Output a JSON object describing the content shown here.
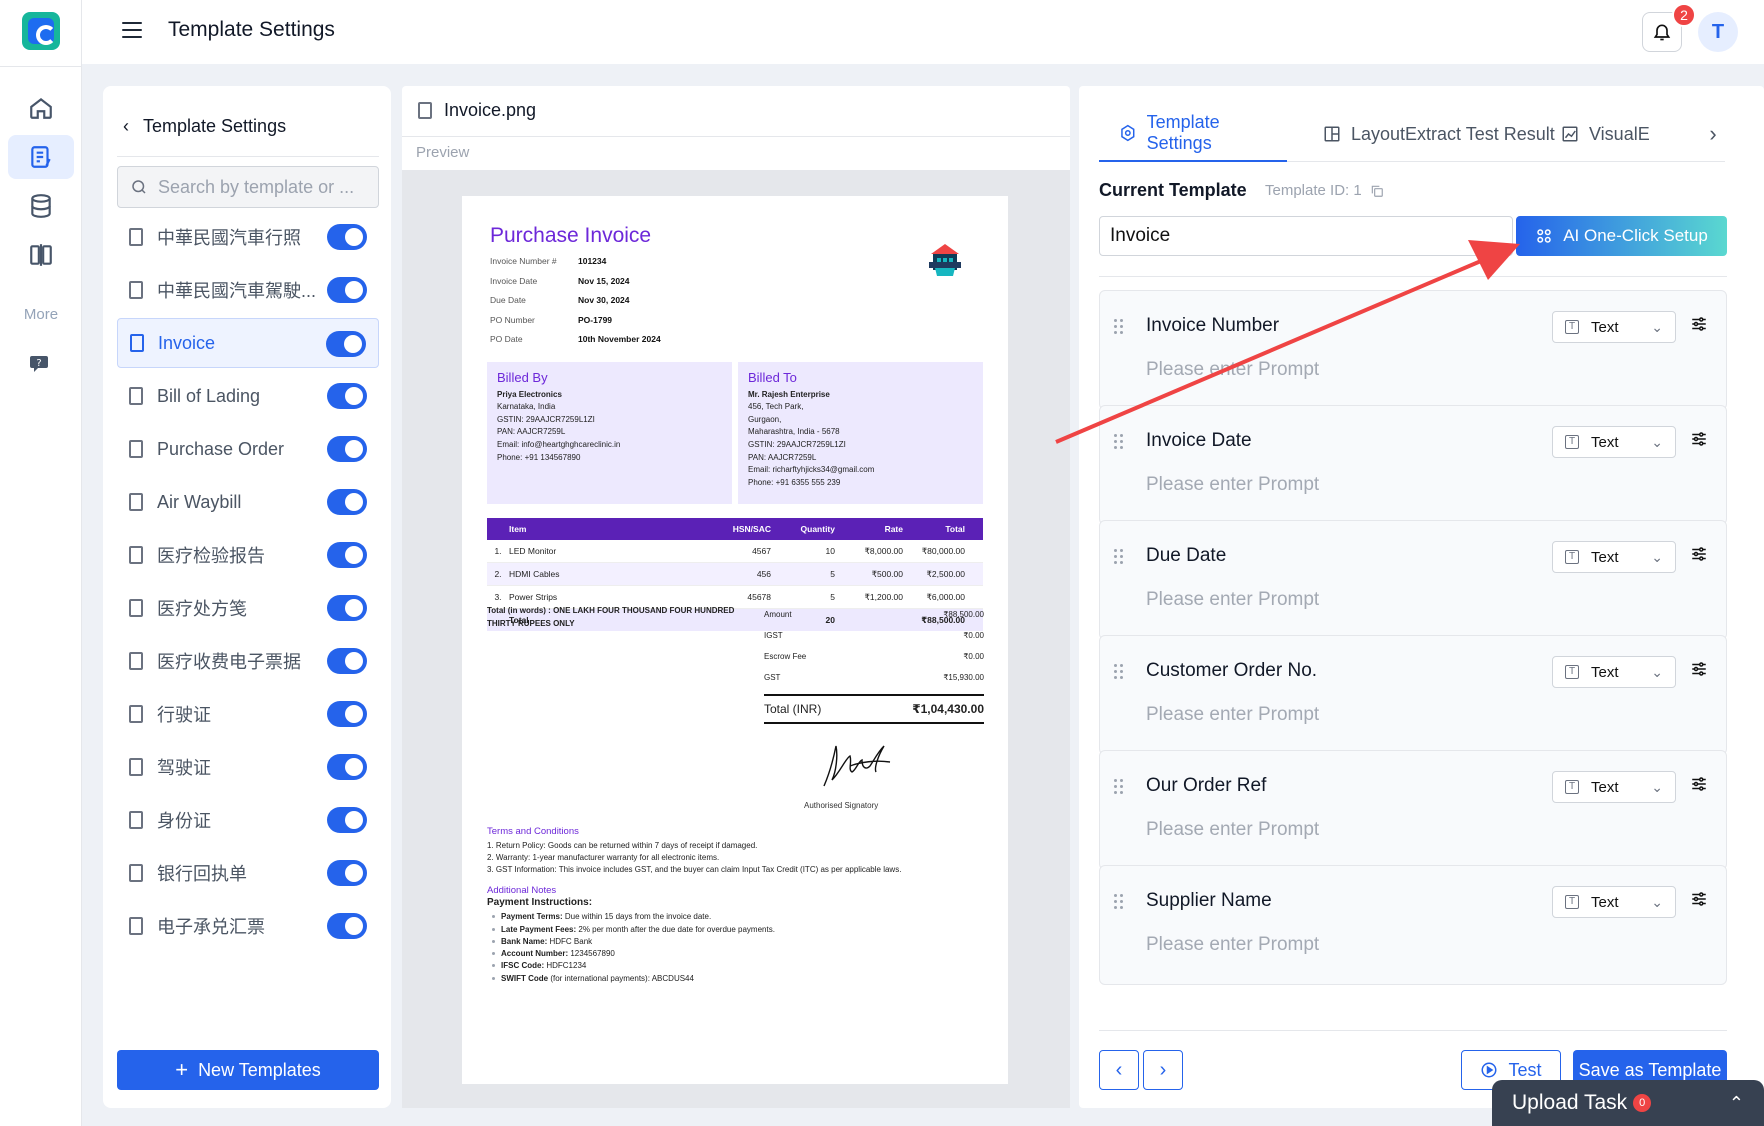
{
  "header": {
    "title": "Template Settings",
    "notification_count": "2",
    "avatar_initial": "T"
  },
  "rail": {
    "more_label": "More",
    "items": [
      "home-icon",
      "templates-icon",
      "database-icon",
      "compare-icon",
      "help-icon"
    ]
  },
  "left_panel": {
    "back_title": "Template Settings",
    "search_placeholder": "Search by template or ...",
    "templates": [
      {
        "label": "中華民國汽車行照",
        "enabled": true
      },
      {
        "label": "中華民國汽車駕駛...",
        "enabled": true
      },
      {
        "label": "Invoice",
        "enabled": true,
        "active": true
      },
      {
        "label": "Bill of Lading",
        "enabled": true
      },
      {
        "label": "Purchase Order",
        "enabled": true
      },
      {
        "label": "Air Waybill",
        "enabled": true
      },
      {
        "label": "医疗检验报告",
        "enabled": true
      },
      {
        "label": "医疗处方笺",
        "enabled": true
      },
      {
        "label": "医疗收费电子票据",
        "enabled": true
      },
      {
        "label": "行驶证",
        "enabled": true
      },
      {
        "label": "驾驶证",
        "enabled": true
      },
      {
        "label": "身份证",
        "enabled": true
      },
      {
        "label": "银行回执单",
        "enabled": true
      },
      {
        "label": "电子承兑汇票",
        "enabled": true
      }
    ],
    "new_button": "New Templates"
  },
  "preview": {
    "file_name": "Invoice.png",
    "label": "Preview",
    "invoice": {
      "title": "Purchase Invoice",
      "meta": [
        {
          "k": "Invoice Number #",
          "v": "101234"
        },
        {
          "k": "Invoice Date",
          "v": "Nov 15, 2024"
        },
        {
          "k": "Due Date",
          "v": "Nov 30, 2024"
        },
        {
          "k": "PO Number",
          "v": "PO-1799"
        },
        {
          "k": "PO Date",
          "v": "10th November 2024"
        }
      ],
      "billed_by": {
        "heading": "Billed By",
        "name": "Priya Electronics",
        "lines": [
          "Karnataka, India",
          "GSTIN: 29AAJCR7259L1ZI",
          "PAN: AAJCR7259L",
          "Email: info@heartghghcareclinic.in",
          "Phone: +91 134567890"
        ]
      },
      "billed_to": {
        "heading": "Billed To",
        "name": "Mr. Rajesh Enterprise",
        "lines": [
          "456, Tech Park,",
          "Gurgaon,",
          "Maharashtra, India - 5678",
          "GSTIN: 29AAJCR7259L1ZI",
          "PAN: AAJCR7259L",
          "Email: richarftyhjicks34@gmail.com",
          "Phone: +91 6355 555 239"
        ]
      },
      "table_headers": [
        "",
        "Item",
        "HSN/SAC",
        "Quantity",
        "Rate",
        "Total"
      ],
      "rows": [
        [
          "1.",
          "LED Monitor",
          "4567",
          "10",
          "₹8,000.00",
          "₹80,000.00"
        ],
        [
          "2.",
          "HDMI Cables",
          "456",
          "5",
          "₹500.00",
          "₹2,500.00"
        ],
        [
          "3.",
          "Power Strips",
          "45678",
          "5",
          "₹1,200.00",
          "₹6,000.00"
        ]
      ],
      "total_row": [
        "",
        "Total",
        "",
        "20",
        "",
        "₹88,500.00"
      ],
      "words": "Total (in words) : ONE LAKH FOUR THOUSAND FOUR HUNDRED THIRTY RUPEES ONLY",
      "sums": [
        {
          "k": "Amount",
          "v": "₹88,500.00"
        },
        {
          "k": "IGST",
          "v": "₹0.00"
        },
        {
          "k": "Escrow Fee",
          "v": "₹0.00"
        },
        {
          "k": "GST",
          "v": "₹15,930.00"
        }
      ],
      "grand_total_label": "Total (INR)",
      "grand_total_value": "₹1,04,430.00",
      "signatory": "Authorised Signatory",
      "terms_heading": "Terms and Conditions",
      "terms": [
        "1. Return Policy: Goods can be returned within 7 days of receipt if damaged.",
        "2. Warranty: 1-year manufacturer warranty for all electronic items.",
        "3. GST Information: This invoice includes GST, and the buyer can claim Input Tax Credit (ITC) as per applicable laws."
      ],
      "notes_heading": "Additional Notes",
      "payment_heading": "Payment Instructions:",
      "payment": [
        {
          "b": "Payment Terms:",
          "t": " Due within 15 days from the invoice date."
        },
        {
          "b": "Late Payment Fees:",
          "t": " 2% per month after the due date for overdue payments."
        },
        {
          "b": "Bank Name:",
          "t": " HDFC Bank"
        },
        {
          "b": "Account Number:",
          "t": " 1234567890"
        },
        {
          "b": "IFSC Code:",
          "t": " HDFC1234"
        },
        {
          "b": "SWIFT Code",
          "t": " (for international payments): ABCDUS44"
        }
      ]
    }
  },
  "right_panel": {
    "tabs": [
      "Template Settings",
      "LayoutExtract Test Result",
      "VisualE"
    ],
    "current_template_label": "Current Template",
    "template_id": "Template ID: 1",
    "template_name": "Invoice",
    "ai_button": "AI One-Click Setup",
    "fields": [
      {
        "name": "Invoice Number",
        "type": "Text",
        "prompt_placeholder": "Please enter Prompt"
      },
      {
        "name": "Invoice Date",
        "type": "Text",
        "prompt_placeholder": "Please enter Prompt"
      },
      {
        "name": "Due Date",
        "type": "Text",
        "prompt_placeholder": "Please enter Prompt"
      },
      {
        "name": "Customer Order No.",
        "type": "Text",
        "prompt_placeholder": "Please enter Prompt"
      },
      {
        "name": "Our Order Ref",
        "type": "Text",
        "prompt_placeholder": "Please enter Prompt"
      },
      {
        "name": "Supplier Name",
        "type": "Text",
        "prompt_placeholder": "Please enter Prompt"
      }
    ],
    "test_button": "Test",
    "save_button": "Save as Template"
  },
  "upload": {
    "label": "Upload Task",
    "count": "0"
  },
  "colors": {
    "primary": "#2563eb",
    "invoice_accent": "#6d28d9",
    "arrow": "#ef4444"
  }
}
